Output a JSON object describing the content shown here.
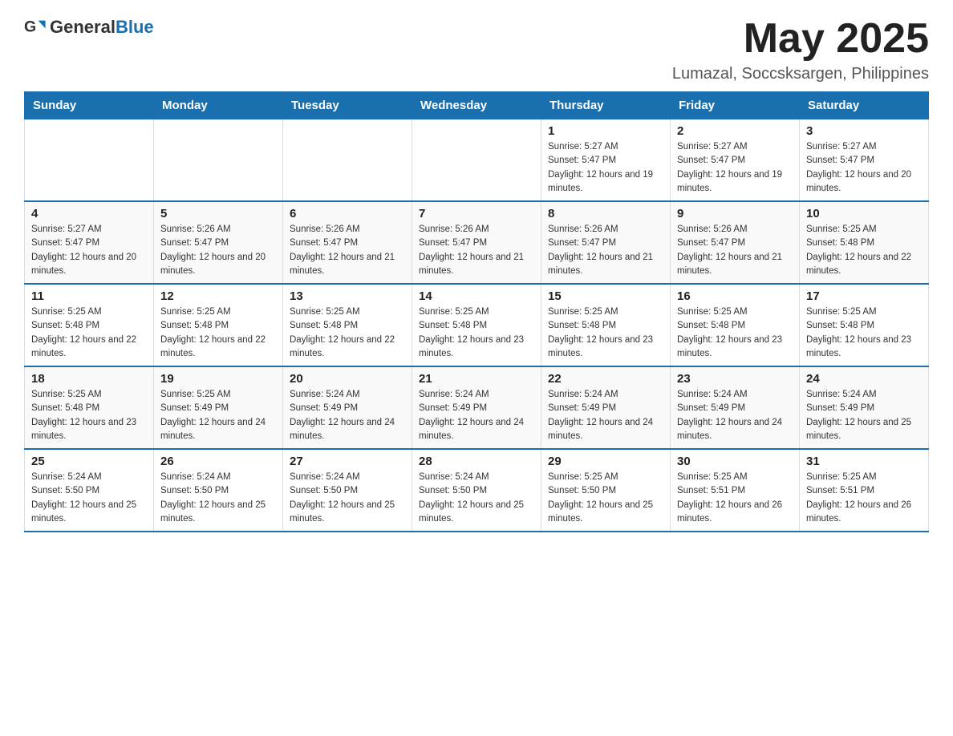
{
  "header": {
    "logo_general": "General",
    "logo_blue": "Blue",
    "month_title": "May 2025",
    "location": "Lumazal, Soccsksargen, Philippines"
  },
  "days_of_week": [
    "Sunday",
    "Monday",
    "Tuesday",
    "Wednesday",
    "Thursday",
    "Friday",
    "Saturday"
  ],
  "weeks": [
    [
      {
        "day": "",
        "info": ""
      },
      {
        "day": "",
        "info": ""
      },
      {
        "day": "",
        "info": ""
      },
      {
        "day": "",
        "info": ""
      },
      {
        "day": "1",
        "info": "Sunrise: 5:27 AM\nSunset: 5:47 PM\nDaylight: 12 hours and 19 minutes."
      },
      {
        "day": "2",
        "info": "Sunrise: 5:27 AM\nSunset: 5:47 PM\nDaylight: 12 hours and 19 minutes."
      },
      {
        "day": "3",
        "info": "Sunrise: 5:27 AM\nSunset: 5:47 PM\nDaylight: 12 hours and 20 minutes."
      }
    ],
    [
      {
        "day": "4",
        "info": "Sunrise: 5:27 AM\nSunset: 5:47 PM\nDaylight: 12 hours and 20 minutes."
      },
      {
        "day": "5",
        "info": "Sunrise: 5:26 AM\nSunset: 5:47 PM\nDaylight: 12 hours and 20 minutes."
      },
      {
        "day": "6",
        "info": "Sunrise: 5:26 AM\nSunset: 5:47 PM\nDaylight: 12 hours and 21 minutes."
      },
      {
        "day": "7",
        "info": "Sunrise: 5:26 AM\nSunset: 5:47 PM\nDaylight: 12 hours and 21 minutes."
      },
      {
        "day": "8",
        "info": "Sunrise: 5:26 AM\nSunset: 5:47 PM\nDaylight: 12 hours and 21 minutes."
      },
      {
        "day": "9",
        "info": "Sunrise: 5:26 AM\nSunset: 5:47 PM\nDaylight: 12 hours and 21 minutes."
      },
      {
        "day": "10",
        "info": "Sunrise: 5:25 AM\nSunset: 5:48 PM\nDaylight: 12 hours and 22 minutes."
      }
    ],
    [
      {
        "day": "11",
        "info": "Sunrise: 5:25 AM\nSunset: 5:48 PM\nDaylight: 12 hours and 22 minutes."
      },
      {
        "day": "12",
        "info": "Sunrise: 5:25 AM\nSunset: 5:48 PM\nDaylight: 12 hours and 22 minutes."
      },
      {
        "day": "13",
        "info": "Sunrise: 5:25 AM\nSunset: 5:48 PM\nDaylight: 12 hours and 22 minutes."
      },
      {
        "day": "14",
        "info": "Sunrise: 5:25 AM\nSunset: 5:48 PM\nDaylight: 12 hours and 23 minutes."
      },
      {
        "day": "15",
        "info": "Sunrise: 5:25 AM\nSunset: 5:48 PM\nDaylight: 12 hours and 23 minutes."
      },
      {
        "day": "16",
        "info": "Sunrise: 5:25 AM\nSunset: 5:48 PM\nDaylight: 12 hours and 23 minutes."
      },
      {
        "day": "17",
        "info": "Sunrise: 5:25 AM\nSunset: 5:48 PM\nDaylight: 12 hours and 23 minutes."
      }
    ],
    [
      {
        "day": "18",
        "info": "Sunrise: 5:25 AM\nSunset: 5:48 PM\nDaylight: 12 hours and 23 minutes."
      },
      {
        "day": "19",
        "info": "Sunrise: 5:25 AM\nSunset: 5:49 PM\nDaylight: 12 hours and 24 minutes."
      },
      {
        "day": "20",
        "info": "Sunrise: 5:24 AM\nSunset: 5:49 PM\nDaylight: 12 hours and 24 minutes."
      },
      {
        "day": "21",
        "info": "Sunrise: 5:24 AM\nSunset: 5:49 PM\nDaylight: 12 hours and 24 minutes."
      },
      {
        "day": "22",
        "info": "Sunrise: 5:24 AM\nSunset: 5:49 PM\nDaylight: 12 hours and 24 minutes."
      },
      {
        "day": "23",
        "info": "Sunrise: 5:24 AM\nSunset: 5:49 PM\nDaylight: 12 hours and 24 minutes."
      },
      {
        "day": "24",
        "info": "Sunrise: 5:24 AM\nSunset: 5:49 PM\nDaylight: 12 hours and 25 minutes."
      }
    ],
    [
      {
        "day": "25",
        "info": "Sunrise: 5:24 AM\nSunset: 5:50 PM\nDaylight: 12 hours and 25 minutes."
      },
      {
        "day": "26",
        "info": "Sunrise: 5:24 AM\nSunset: 5:50 PM\nDaylight: 12 hours and 25 minutes."
      },
      {
        "day": "27",
        "info": "Sunrise: 5:24 AM\nSunset: 5:50 PM\nDaylight: 12 hours and 25 minutes."
      },
      {
        "day": "28",
        "info": "Sunrise: 5:24 AM\nSunset: 5:50 PM\nDaylight: 12 hours and 25 minutes."
      },
      {
        "day": "29",
        "info": "Sunrise: 5:25 AM\nSunset: 5:50 PM\nDaylight: 12 hours and 25 minutes."
      },
      {
        "day": "30",
        "info": "Sunrise: 5:25 AM\nSunset: 5:51 PM\nDaylight: 12 hours and 26 minutes."
      },
      {
        "day": "31",
        "info": "Sunrise: 5:25 AM\nSunset: 5:51 PM\nDaylight: 12 hours and 26 minutes."
      }
    ]
  ]
}
